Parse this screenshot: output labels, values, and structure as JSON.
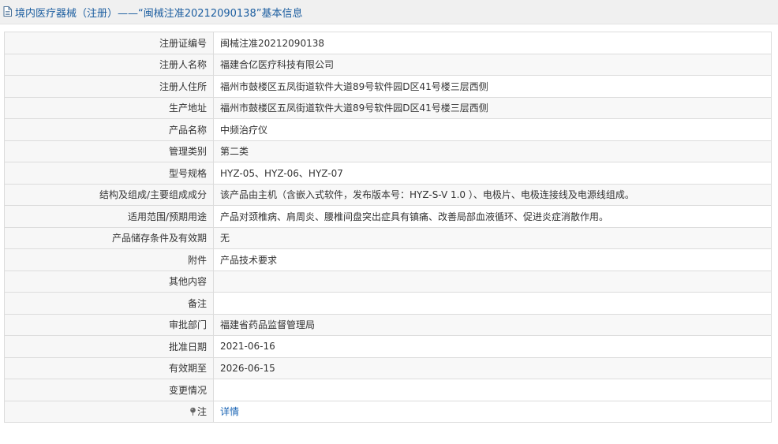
{
  "header": {
    "title": "境内医疗器械（注册）——“闽械注准20212090138”基本信息",
    "icon": "document-icon"
  },
  "rows": [
    {
      "label": "注册证编号",
      "value": "闽械注准20212090138"
    },
    {
      "label": "注册人名称",
      "value": "福建合亿医疗科技有限公司"
    },
    {
      "label": "注册人住所",
      "value": "福州市鼓楼区五凤街道软件大道89号软件园D区41号楼三层西侧"
    },
    {
      "label": "生产地址",
      "value": "福州市鼓楼区五凤街道软件大道89号软件园D区41号楼三层西侧"
    },
    {
      "label": "产品名称",
      "value": "中频治疗仪"
    },
    {
      "label": "管理类别",
      "value": "第二类"
    },
    {
      "label": "型号规格",
      "value": "HYZ-05、HYZ-06、HYZ-07"
    },
    {
      "label": "结构及组成/主要组成成分",
      "value": "该产品由主机（含嵌入式软件，发布版本号：HYZ-S-V 1.0 ）、电极片、电极连接线及电源线组成。"
    },
    {
      "label": "适用范围/预期用途",
      "value": "产品对颈椎病、肩周炎、腰椎间盘突出症具有镇痛、改善局部血液循环、促进炎症消散作用。"
    },
    {
      "label": "产品储存条件及有效期",
      "value": "无"
    },
    {
      "label": "附件",
      "value": "产品技术要求"
    },
    {
      "label": "其他内容",
      "value": ""
    },
    {
      "label": "备注",
      "value": ""
    },
    {
      "label": "审批部门",
      "value": "福建省药品监督管理局"
    },
    {
      "label": "批准日期",
      "value": "2021-06-16"
    },
    {
      "label": "有效期至",
      "value": "2026-06-15"
    },
    {
      "label": "变更情况",
      "value": ""
    }
  ],
  "note_row": {
    "icon": "pin-icon",
    "label": "注",
    "link_text": "详情"
  },
  "colors": {
    "header_bg": "#f0f0f0",
    "title": "#1c5ea0",
    "link": "#1a64b4",
    "border": "#dcdcdc"
  }
}
